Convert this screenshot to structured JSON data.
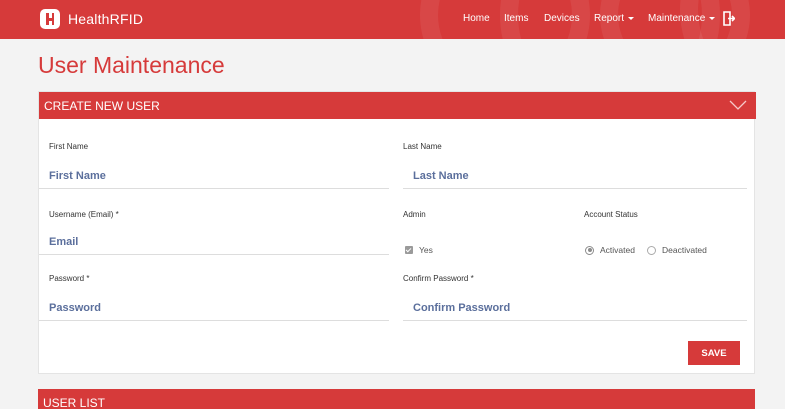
{
  "brand": {
    "name": "HealthRFID"
  },
  "nav": {
    "items": [
      "Home",
      "Items",
      "Devices",
      "Report",
      "Maintenance"
    ],
    "logout_icon": "logout-icon"
  },
  "page_title": "User Maintenance",
  "create_panel": {
    "title": "CREATE NEW USER",
    "first_name": {
      "label": "First Name",
      "placeholder": "First Name"
    },
    "last_name": {
      "label": "Last Name",
      "placeholder": "Last Name"
    },
    "username": {
      "label": "Username (Email) *",
      "placeholder": "Email"
    },
    "admin": {
      "label": "Admin",
      "option": "Yes",
      "checked": true
    },
    "account_status": {
      "label": "Account Status",
      "options": [
        "Activated",
        "Deactivated"
      ],
      "selected": "Activated"
    },
    "password": {
      "label": "Password *",
      "placeholder": "Password"
    },
    "confirm_password": {
      "label": "Confirm Password *",
      "placeholder": "Confirm Password"
    },
    "save_label": "SAVE"
  },
  "user_list_panel": {
    "title": "USER LIST"
  },
  "colors": {
    "accent": "#d63a3a",
    "field_text": "#5b6f9c"
  }
}
